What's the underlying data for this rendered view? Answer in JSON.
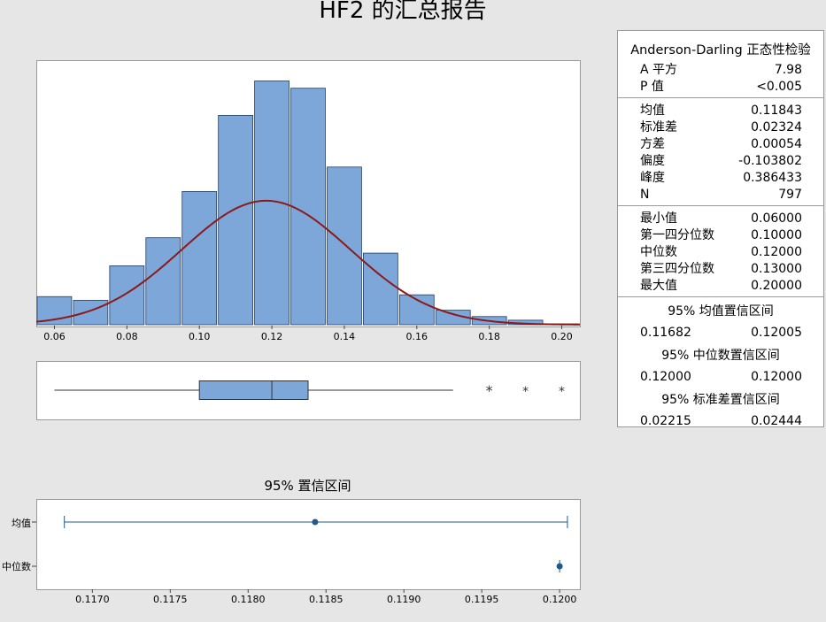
{
  "title": "HF2 的汇总报告",
  "stats": {
    "ad_title": "Anderson-Darling 正态性检验",
    "ad": [
      {
        "label": "A 平方",
        "value": "7.98"
      },
      {
        "label": "P 值",
        "value": "<0.005"
      }
    ],
    "moments": [
      {
        "label": "均值",
        "value": "0.11843"
      },
      {
        "label": "标准差",
        "value": "0.02324"
      },
      {
        "label": "方差",
        "value": "0.00054"
      },
      {
        "label": "偏度",
        "value": "-0.103802"
      },
      {
        "label": "峰度",
        "value": "0.386433"
      },
      {
        "label": "N",
        "value": "797"
      }
    ],
    "quantiles": [
      {
        "label": "最小值",
        "value": "0.06000"
      },
      {
        "label": "第一四分位数",
        "value": "0.10000"
      },
      {
        "label": "中位数",
        "value": "0.12000"
      },
      {
        "label": "第三四分位数",
        "value": "0.13000"
      },
      {
        "label": "最大值",
        "value": "0.20000"
      }
    ],
    "intervals": [
      {
        "title": "95% 均值置信区间",
        "low": "0.11682",
        "high": "0.12005"
      },
      {
        "title": "95% 中位数置信区间",
        "low": "0.12000",
        "high": "0.12000"
      },
      {
        "title": "95% 标准差置信区间",
        "low": "0.02215",
        "high": "0.02444"
      }
    ]
  },
  "ci_chart_title": "95% 置信区间",
  "ci_labels": {
    "mean": "均值",
    "median": "中位数"
  },
  "colors": {
    "bar": "#7da7d9",
    "bar_stroke": "#1f3c66",
    "curve": "#8b1a1a",
    "ci": "#1f5a8a"
  },
  "chart_data": [
    {
      "type": "bar",
      "name": "histogram",
      "x": [
        0.06,
        0.07,
        0.08,
        0.09,
        0.1,
        0.11,
        0.12,
        0.13,
        0.14,
        0.15,
        0.16,
        0.17,
        0.18,
        0.19,
        0.2
      ],
      "values": [
        31,
        27,
        65,
        96,
        147,
        231,
        269,
        261,
        174,
        79,
        33,
        16,
        9,
        5,
        1
      ],
      "xlim": [
        0.055,
        0.205
      ],
      "xticks": [
        "0.06",
        "0.08",
        "0.10",
        "0.12",
        "0.14",
        "0.16",
        "0.18",
        "0.20"
      ],
      "normal_fit": {
        "mean": 0.11843,
        "sd": 0.02324,
        "n": 797,
        "bin_width": 0.01
      }
    },
    {
      "type": "boxplot",
      "name": "boxplot",
      "whisker_low": 0.06,
      "q1": 0.1,
      "median": 0.12,
      "q3": 0.13,
      "whisker_high": 0.17,
      "outliers": [
        0.18,
        0.19,
        0.2
      ],
      "xlim": [
        0.055,
        0.205
      ]
    },
    {
      "type": "interval",
      "name": "confidence_intervals",
      "title": "95% 置信区间",
      "xlim": [
        0.11664,
        0.12013
      ],
      "xticks": [
        "0.1170",
        "0.1175",
        "0.1180",
        "0.1185",
        "0.1190",
        "0.1195",
        "0.1200"
      ],
      "mean": {
        "low": 0.11682,
        "estimate": 0.11843,
        "high": 0.12005
      },
      "median": {
        "low": 0.12,
        "estimate": 0.12,
        "high": 0.12
      }
    }
  ]
}
